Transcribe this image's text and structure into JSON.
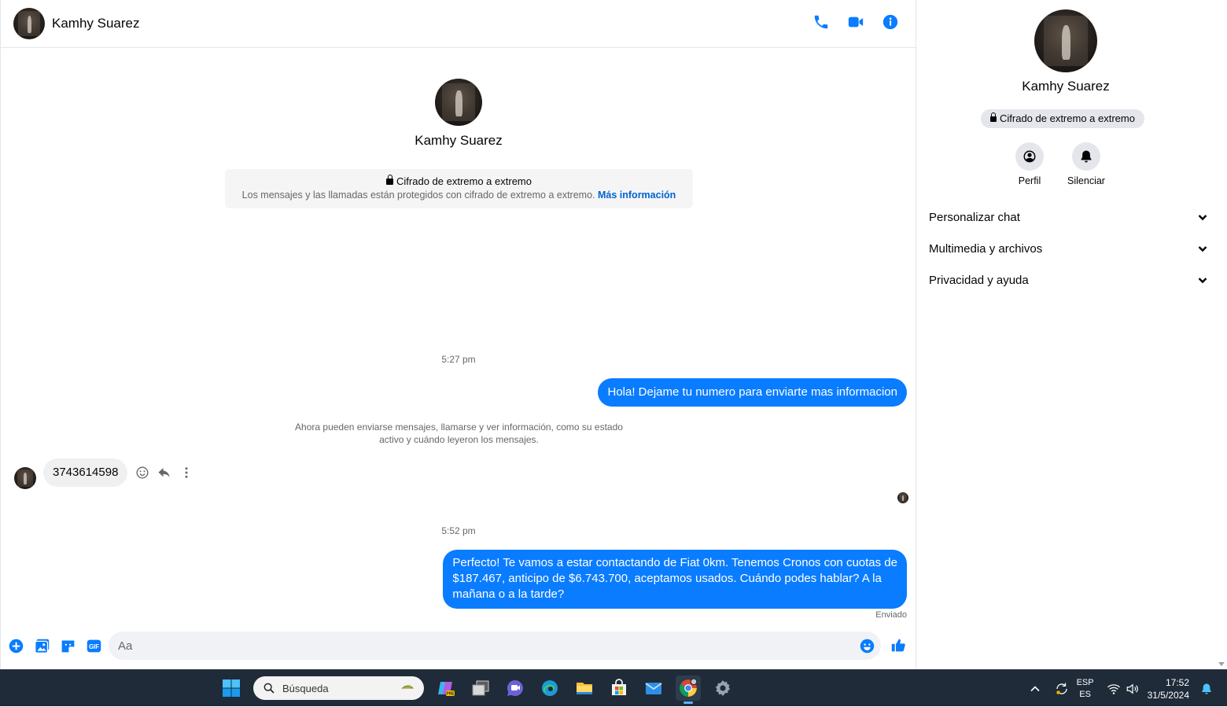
{
  "header": {
    "contact_name": "Kamhy Suarez",
    "icons": [
      "phone-icon",
      "video-camera-icon",
      "info-icon"
    ]
  },
  "intro": {
    "contact_name": "Kamhy Suarez",
    "e2e_title": "Cifrado de extremo a extremo",
    "e2e_desc": "Los mensajes y las llamadas están protegidos con cifrado de extremo a extremo.",
    "e2e_link": "Más información"
  },
  "messages": {
    "ts1": "5:27 pm",
    "out1": "Hola! Dejame tu numero para enviarte mas informacion",
    "system_line1": "Ahora pueden enviarse mensajes, llamarse y ver información, como su estado",
    "system_line2": "activo y cuándo leyeron los mensajes.",
    "in1": "3743614598",
    "ts2": "5:52 pm",
    "out2_line1": "Perfecto! Te vamos a estar contactando de Fiat 0km. Tenemos Cronos con cuotas de",
    "out2_line2": "$187.467, anticipo de $6.743.700, aceptamos usados. Cuándo podes hablar? A la",
    "out2_line3": "mañana o a la tarde?",
    "status": "Enviado"
  },
  "composer": {
    "placeholder": "Aa",
    "value": ""
  },
  "sidebar": {
    "contact_name": "Kamhy Suarez",
    "e2e_badge": "Cifrado de extremo a extremo",
    "actions": [
      {
        "label": "Perfil",
        "icon": "profile-icon"
      },
      {
        "label": "Silenciar",
        "icon": "bell-icon"
      }
    ],
    "menu": [
      {
        "label": "Personalizar chat"
      },
      {
        "label": "Multimedia y archivos"
      },
      {
        "label": "Privacidad y ayuda"
      }
    ]
  },
  "taskbar": {
    "search_placeholder": "Búsqueda",
    "lang_top": "ESP",
    "lang_bottom": "ES",
    "time": "17:52",
    "date": "31/5/2024"
  },
  "colors": {
    "accent": "#0a7cff",
    "link": "#0064d1",
    "taskbar": "#1f2b38"
  }
}
